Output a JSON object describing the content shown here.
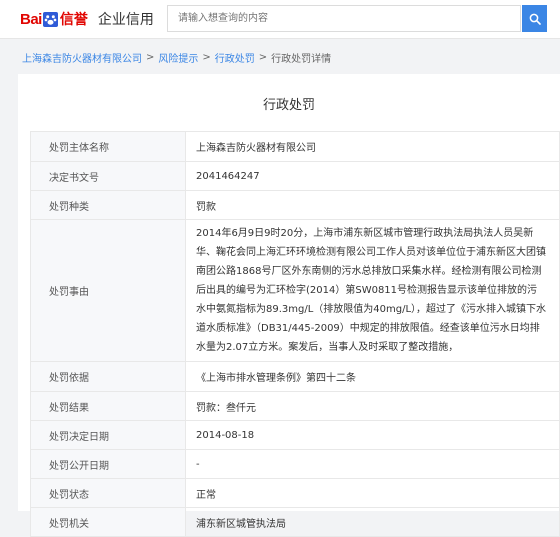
{
  "header": {
    "logo_bai": "Bai",
    "logo_xin": "信誉",
    "logo_product": "企业信用",
    "search_placeholder": "请输入想查询的内容"
  },
  "breadcrumb": [
    "上海森吉防火器材有限公司",
    "风险提示",
    "行政处罚",
    "行政处罚详情"
  ],
  "page_title": "行政处罚",
  "rows": [
    {
      "label": "处罚主体名称",
      "value": "上海森吉防火器材有限公司"
    },
    {
      "label": "决定书文号",
      "value": "2041464247"
    },
    {
      "label": "处罚种类",
      "value": "罚款"
    },
    {
      "label": "处罚事由",
      "value": "2014年6月9日9时20分，上海市浦东新区城市管理行政执法局执法人员吴新华、鞠花会同上海汇环环境检测有限公司工作人员对该单位位于浦东新区大团镇南团公路1868号厂区外东南侧的污水总排放口采集水样。经检测有限公司检测后出具的编号为汇环检字(2014）第SW0811号检测报告显示该单位排放的污水中氨氮指标为89.3mg/L（排放限值为40mg/L），超过了《污水排入城镇下水道水质标准》（DB31/445-2009）中规定的排放限值。经查该单位污水日均排水量为2.07立方米。案发后，当事人及时采取了整改措施，"
    },
    {
      "label": "处罚依据",
      "value": "《上海市排水管理条例》第四十二条"
    },
    {
      "label": "处罚结果",
      "value": "罚款：叁仟元"
    },
    {
      "label": "处罚决定日期",
      "value": "2014-08-18"
    },
    {
      "label": "处罚公开日期",
      "value": "-"
    },
    {
      "label": "处罚状态",
      "value": "正常"
    },
    {
      "label": "处罚机关",
      "value": "浦东新区城管执法局"
    }
  ],
  "colors": {
    "brand_red": "#e10602",
    "link_blue": "#3b86e5",
    "label_bg": "#f7f8fa"
  }
}
